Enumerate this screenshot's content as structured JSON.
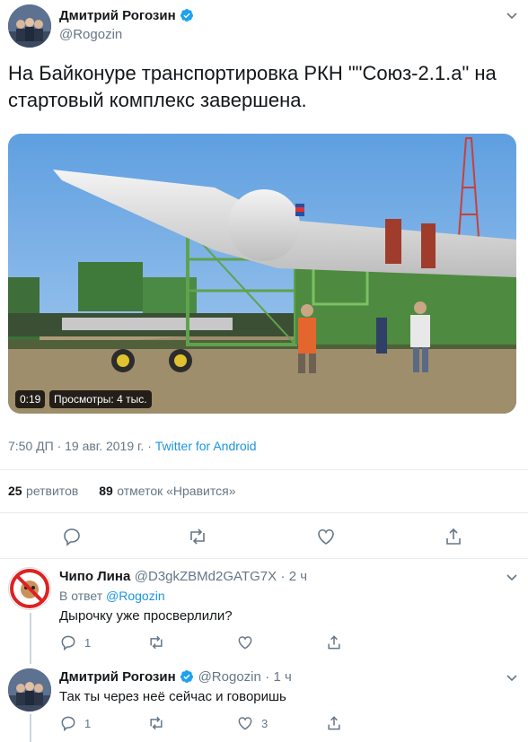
{
  "main_tweet": {
    "author_name": "Дмитрий Рогозин",
    "author_handle": "@Rogozin",
    "text": "На Байконуре транспортировка РКН \"\"Союз-2.1.а\" на стартовый комплекс завершена.",
    "video": {
      "duration": "0:19",
      "views": "Просмотры: 4 тыс."
    },
    "time": "7:50 ДП · 19 авг. 2019 г. · ",
    "source": "Twitter for Android",
    "retweets_count": "25",
    "retweets_label": "ретвитов",
    "likes_count": "89",
    "likes_label": "отметок «Нравится»"
  },
  "replies": [
    {
      "author_name": "Чипо Лина",
      "author_handle": "@D3gkZBMd2GATG7X",
      "time": "· 2 ч",
      "reply_to_prefix": "В ответ ",
      "reply_to_handle": "@Rogozin",
      "text": "Дырочку уже просверлили?",
      "reply_count": "1",
      "retweet_count": "",
      "like_count": ""
    },
    {
      "author_name": "Дмитрий Рогозин",
      "author_handle": "@Rogozin",
      "time": "· 1 ч",
      "text": "Так ты через неё сейчас и говоришь",
      "reply_count": "1",
      "retweet_count": "",
      "like_count": "3"
    }
  ],
  "colors": {
    "accent": "#1b95e0",
    "muted": "#657786",
    "divider": "#e6ecf0"
  },
  "icons": [
    "verified-icon",
    "chevron-down-icon",
    "reply-icon",
    "retweet-icon",
    "like-icon",
    "share-icon"
  ]
}
